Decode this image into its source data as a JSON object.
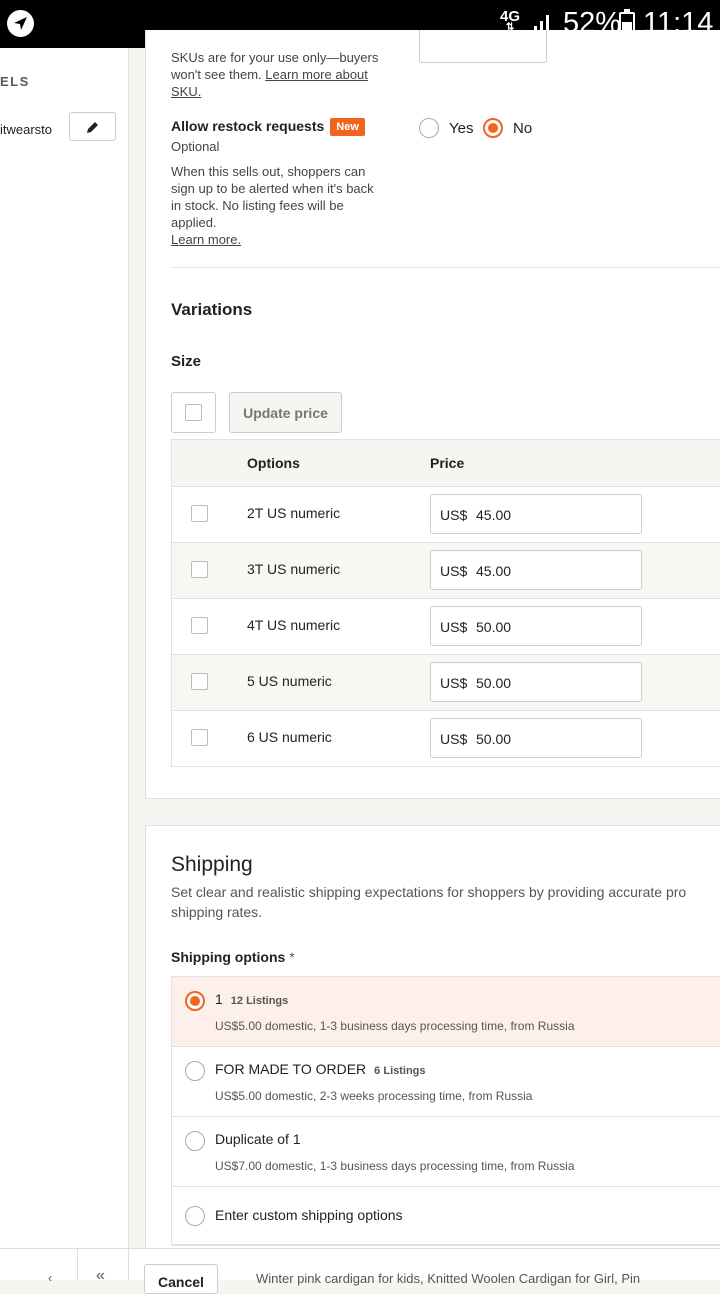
{
  "status_bar": {
    "network": "4G",
    "battery_percent": "52%",
    "battery_level": 0.52,
    "time": "11:14"
  },
  "sidebar": {
    "section_label": "ELS",
    "shop_name": "itwearsto"
  },
  "sku": {
    "help_text": "SKUs are for your use only—buyers won't see them.",
    "help_link": "Learn more about SKU."
  },
  "restock": {
    "title": "Allow restock requests",
    "badge": "New",
    "optional": "Optional",
    "help_text": "When this sells out, shoppers can sign up to be alerted when it's back in stock. No listing fees will be applied.",
    "help_link": "Learn more.",
    "options": [
      {
        "label": "Yes",
        "selected": false
      },
      {
        "label": "No",
        "selected": true
      }
    ]
  },
  "variations": {
    "title": "Variations",
    "property_label": "Size",
    "update_price_label": "Update price",
    "columns": [
      "Options",
      "Price"
    ],
    "rows": [
      {
        "option": "2T US numeric",
        "currency": "US$",
        "price": "45.00"
      },
      {
        "option": "3T US numeric",
        "currency": "US$",
        "price": "45.00"
      },
      {
        "option": "4T US numeric",
        "currency": "US$",
        "price": "50.00"
      },
      {
        "option": "5 US numeric",
        "currency": "US$",
        "price": "50.00"
      },
      {
        "option": "6 US numeric",
        "currency": "US$",
        "price": "50.00"
      }
    ]
  },
  "shipping": {
    "title": "Shipping",
    "description_line1": "Set clear and realistic shipping expectations for shoppers by providing accurate pro",
    "description_line2": "shipping rates.",
    "options_label": "Shipping options",
    "required_mark": "*",
    "options": [
      {
        "name": "1",
        "count": "12 Listings",
        "detail": "US$5.00 domestic, 1-3 business days processing time, from Russia",
        "selected": true
      },
      {
        "name": "FOR MADE TO ORDER",
        "count": "6 Listings",
        "detail": "US$5.00 domestic, 2-3 weeks processing time, from Russia",
        "selected": false
      },
      {
        "name": "Duplicate of 1",
        "count": "",
        "detail": "US$7.00 domestic, 1-3 business days processing time, from Russia",
        "selected": false
      },
      {
        "name": "Enter custom shipping options",
        "count": "",
        "detail": "",
        "selected": false
      }
    ]
  },
  "bottom_bar": {
    "back_glyph": "«",
    "cancel_label": "Cancel",
    "listing_title": "Winter pink cardigan for kids, Knitted Woolen Cardigan for Girl, Pin"
  }
}
